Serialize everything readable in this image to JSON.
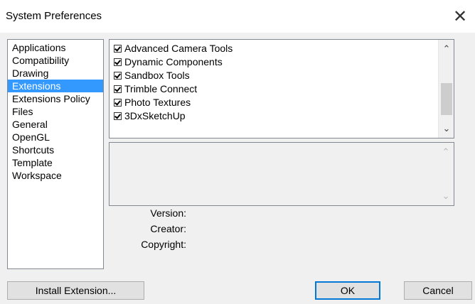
{
  "window": {
    "title": "System Preferences",
    "close_glyph": "✕"
  },
  "categories": [
    {
      "label": "Applications",
      "selected": false
    },
    {
      "label": "Compatibility",
      "selected": false
    },
    {
      "label": "Drawing",
      "selected": false
    },
    {
      "label": "Extensions",
      "selected": true
    },
    {
      "label": "Extensions Policy",
      "selected": false
    },
    {
      "label": "Files",
      "selected": false
    },
    {
      "label": "General",
      "selected": false
    },
    {
      "label": "OpenGL",
      "selected": false
    },
    {
      "label": "Shortcuts",
      "selected": false
    },
    {
      "label": "Template",
      "selected": false
    },
    {
      "label": "Workspace",
      "selected": false
    }
  ],
  "extensions": [
    {
      "label": "Advanced Camera Tools",
      "checked": true
    },
    {
      "label": "Dynamic Components",
      "checked": true
    },
    {
      "label": "Sandbox Tools",
      "checked": true
    },
    {
      "label": "Trimble Connect",
      "checked": true
    },
    {
      "label": "Photo Textures",
      "checked": true
    },
    {
      "label": "3DxSketchUp",
      "checked": true
    }
  ],
  "scroll": {
    "up_glyph": "⌃",
    "down_glyph": "⌄"
  },
  "info": {
    "version_label": "Version:",
    "creator_label": "Creator:",
    "copyright_label": "Copyright:"
  },
  "buttons": {
    "install": "Install Extension...",
    "ok": "OK",
    "cancel": "Cancel"
  },
  "colors": {
    "selection": "#3399ff",
    "dialog_bg": "#f0f0f0",
    "accent_border": "#0078d7"
  }
}
